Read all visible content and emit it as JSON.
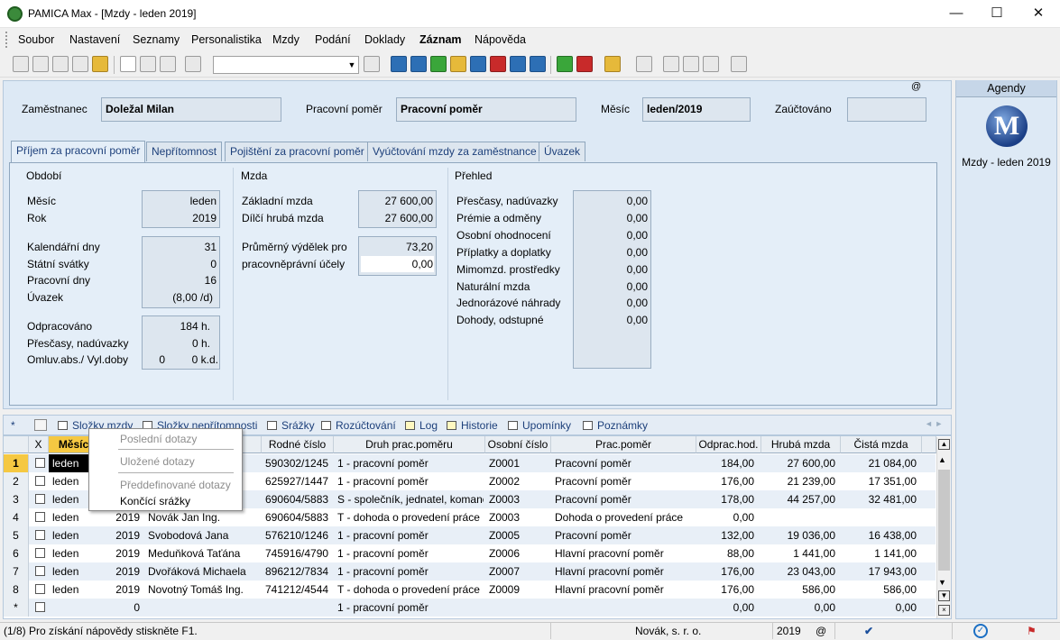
{
  "window": {
    "title": "PAMICA Max - [Mzdy - leden 2019]",
    "minimize": "—",
    "maximize": "☐",
    "close": "✕"
  },
  "menu": [
    "Soubor",
    "Nastavení",
    "Seznamy",
    "Personalistika",
    "Mzdy",
    "Podání",
    "Doklady",
    "Záznam",
    "Nápověda"
  ],
  "header": {
    "employee_label": "Zaměstnanec",
    "employee_value": "Doležal Milan",
    "relation_label": "Pracovní poměr",
    "relation_value": "Pracovní poměr",
    "month_label": "Měsíc",
    "month_value": "leden/2019",
    "posted_label": "Zaúčtováno",
    "posted_value": "",
    "at_symbol": "@"
  },
  "tabs": [
    "Příjem za pracovní poměr",
    "Nepřítomnost",
    "Pojištění za pracovní poměr",
    "Vyúčtování mzdy za zaměstnance",
    "Úvazek"
  ],
  "period": {
    "title": "Období",
    "month_label": "Měsíc",
    "month": "leden",
    "year_label": "Rok",
    "year": "2019",
    "cal_days_label": "Kalendářní dny",
    "cal_days": "31",
    "holidays_label": "Státní svátky",
    "holidays": "0",
    "work_days_label": "Pracovní dny",
    "work_days": "16",
    "load_label": "Úvazek",
    "load": "(8,00 /d)",
    "worked_label": "Odpracováno",
    "worked": "184 h.",
    "overtime_label": "Přesčasy, nadúvazky",
    "overtime": "0 h.",
    "absence_label": "Omluv.abs./ Vyl.doby",
    "absence_a": "0",
    "absence_b": "0 k.d."
  },
  "wage": {
    "title": "Mzda",
    "base_label": "Základní mzda",
    "base": "27 600,00",
    "partial_label": "Dílčí hrubá mzda",
    "partial": "27 600,00",
    "avg_label_1": "Průměrný výdělek pro",
    "avg_1": "73,20",
    "avg_label_2": "pracovněprávní účely",
    "avg_2": "0,00"
  },
  "overview": {
    "title": "Přehled",
    "items": [
      {
        "label": "Přesčasy, nadúvazky",
        "value": "0,00"
      },
      {
        "label": "Prémie a odměny",
        "value": "0,00"
      },
      {
        "label": "Osobní ohodnocení",
        "value": "0,00"
      },
      {
        "label": "Příplatky a doplatky",
        "value": "0,00"
      },
      {
        "label": "Mimomzd. prostředky",
        "value": "0,00"
      },
      {
        "label": "Naturální mzda",
        "value": "0,00"
      },
      {
        "label": "Jednorázové náhrady",
        "value": "0,00"
      },
      {
        "label": "Dohody, odstupné",
        "value": "0,00"
      }
    ]
  },
  "lower_tabs": {
    "star": "*",
    "items": [
      "Složky mzdy",
      "Složky nepřítomnosti",
      "Srážky",
      "Rozúčtování",
      "Log",
      "Historie",
      "Upomínky",
      "Poznámky"
    ]
  },
  "grid": {
    "headers": [
      "X",
      "Měsíc",
      "",
      "",
      "Rodné číslo",
      "Druh prac.poměru",
      "Osobní číslo",
      "Prac.poměr",
      "Odprac.hod.",
      "Hrubá mzda",
      "Čistá mzda"
    ],
    "rows": [
      {
        "n": "1",
        "month": "leden",
        "year": "",
        "name": "",
        "rc": "590302/1245",
        "type": "1 - pracovní poměr",
        "os": "Z0001",
        "rel": "Pracovní poměr",
        "hours": "184,00",
        "gross": "27 600,00",
        "net": "21 084,00"
      },
      {
        "n": "2",
        "month": "leden",
        "year": "",
        "name": "",
        "rc": "625927/1447",
        "type": "1 - pracovní poměr",
        "os": "Z0002",
        "rel": "Pracovní poměr",
        "hours": "176,00",
        "gross": "21 239,00",
        "net": "17 351,00"
      },
      {
        "n": "3",
        "month": "leden",
        "year": "",
        "name": "",
        "rc": "690604/5883",
        "type": "S - společník, jednatel, komanc",
        "os": "Z0003",
        "rel": "Pracovní poměr",
        "hours": "178,00",
        "gross": "44 257,00",
        "net": "32 481,00"
      },
      {
        "n": "4",
        "month": "leden",
        "year": "2019",
        "name": "Novák Jan Ing.",
        "rc": "690604/5883",
        "type": "T - dohoda o provedení práce",
        "os": "Z0003",
        "rel": "Dohoda o provedení práce",
        "hours": "0,00",
        "gross": "",
        "net": ""
      },
      {
        "n": "5",
        "month": "leden",
        "year": "2019",
        "name": "Svobodová Jana",
        "rc": "576210/1246",
        "type": "1 - pracovní poměr",
        "os": "Z0005",
        "rel": "Pracovní poměr",
        "hours": "132,00",
        "gross": "19 036,00",
        "net": "16 438,00"
      },
      {
        "n": "6",
        "month": "leden",
        "year": "2019",
        "name": "Meduňková Taťána",
        "rc": "745916/4790",
        "type": "1 - pracovní poměr",
        "os": "Z0006",
        "rel": "Hlavní pracovní poměr",
        "hours": "88,00",
        "gross": "1 441,00",
        "net": "1 141,00"
      },
      {
        "n": "7",
        "month": "leden",
        "year": "2019",
        "name": "Dvořáková Michaela",
        "rc": "896212/7834",
        "type": "1 - pracovní poměr",
        "os": "Z0007",
        "rel": "Hlavní pracovní poměr",
        "hours": "176,00",
        "gross": "23 043,00",
        "net": "17 943,00"
      },
      {
        "n": "8",
        "month": "leden",
        "year": "2019",
        "name": "Novotný Tomáš Ing.",
        "rc": "741212/4544",
        "type": "T - dohoda o provedení práce",
        "os": "Z0009",
        "rel": "Hlavní pracovní poměr",
        "hours": "176,00",
        "gross": "586,00",
        "net": "586,00"
      },
      {
        "n": "*",
        "month": "",
        "year": "0",
        "name": "",
        "rc": "",
        "type": "1 - pracovní poměr",
        "os": "",
        "rel": "",
        "hours": "0,00",
        "gross": "0,00",
        "net": "0,00"
      }
    ]
  },
  "dropdown": {
    "recent": "Poslední dotazy",
    "saved": "Uložené dotazy",
    "predefined": "Předdefinované dotazy",
    "ending": "Končící srážky"
  },
  "agenda": {
    "title": "Agendy",
    "logo_letter": "M",
    "item": "Mzdy - leden 2019"
  },
  "status": {
    "help": "(1/8) Pro získání nápovědy stiskněte F1.",
    "company": "Novák, s. r. o.",
    "year": "2019",
    "at": "@"
  },
  "colors": {
    "form_bg": "#dde9f5",
    "selected_row": "#f5c842",
    "row_alt": "#e8eff7"
  }
}
